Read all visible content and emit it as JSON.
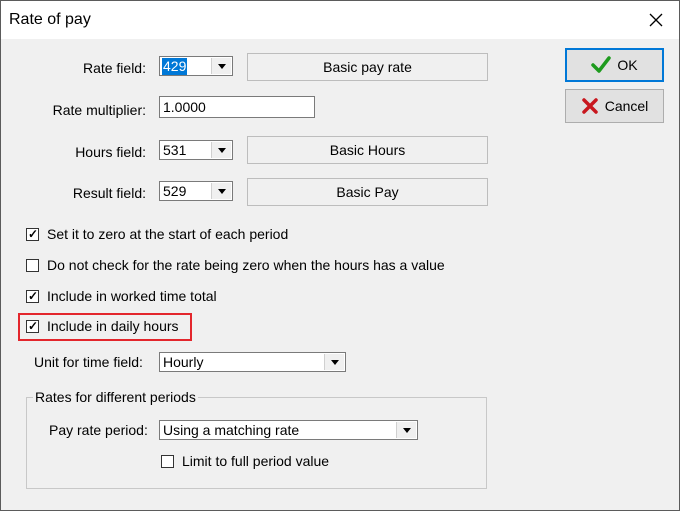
{
  "window": {
    "title": "Rate of pay"
  },
  "buttons": {
    "ok": "OK",
    "cancel": "Cancel"
  },
  "fields": {
    "rate_field": {
      "label": "Rate field:",
      "value": "429",
      "description": "Basic pay rate"
    },
    "rate_multiplier": {
      "label": "Rate multiplier:",
      "value": "1.0000"
    },
    "hours_field": {
      "label": "Hours field:",
      "value": "531",
      "description": "Basic Hours"
    },
    "result_field": {
      "label": "Result field:",
      "value": "529",
      "description": "Basic Pay"
    }
  },
  "checkboxes": {
    "set_zero": {
      "label": "Set it to zero at the start of each period",
      "checked": true
    },
    "no_check_zero": {
      "label": "Do not check for the rate being zero when the hours has a value",
      "checked": false
    },
    "worked_time": {
      "label": "Include in worked time total",
      "checked": true
    },
    "daily_hours": {
      "label": "Include in daily hours",
      "checked": true
    }
  },
  "unit_time": {
    "label": "Unit for time field:",
    "value": "Hourly"
  },
  "rates_group": {
    "title": "Rates for different periods",
    "pay_rate_period": {
      "label": "Pay rate period:",
      "value": "Using a matching rate"
    },
    "limit_full_period": {
      "label": "Limit to full period value",
      "checked": false
    }
  },
  "colors": {
    "highlight": "#e3262c",
    "ok_icon": "#1e9b1e",
    "cancel_icon": "#c8171e",
    "selection": "#0078d7"
  }
}
